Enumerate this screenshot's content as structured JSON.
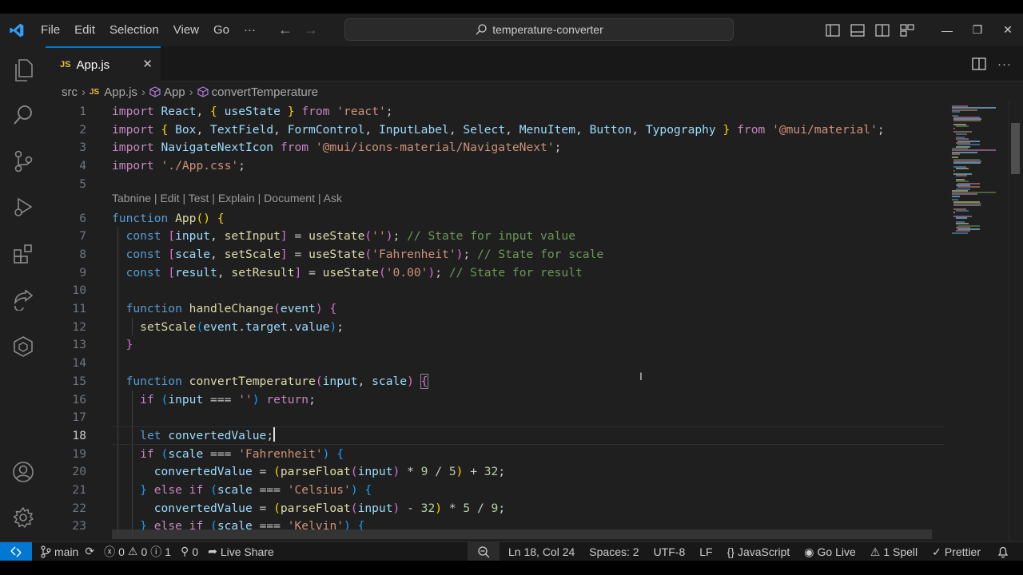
{
  "window": {
    "menu": [
      "File",
      "Edit",
      "Selection",
      "View",
      "Go",
      "···"
    ],
    "search_title": "temperature-converter",
    "controls": {
      "minimize": "—",
      "restore": "❐",
      "close": "✕"
    }
  },
  "tab": {
    "lang_badge": "JS",
    "label": "App.js",
    "close": "✕"
  },
  "breadcrumb": {
    "folder": "src",
    "file": "App.js",
    "symbol1": "App",
    "symbol2": "convertTemperature"
  },
  "codelens": "Tabnine | Edit | Test | Explain | Document | Ask",
  "editor": {
    "active_line": 18,
    "lines": [
      {
        "n": "1",
        "html": "<span class='kc'>import</span> <span class='var'>React</span>, <span class='b1'>{</span> <span class='var'>useState</span> <span class='b1'>}</span> <span class='kc'>from</span> <span class='str'>'react'</span>;"
      },
      {
        "n": "2",
        "html": "<span class='kc'>import</span> <span class='b1'>{</span> <span class='var'>Box</span>, <span class='var'>TextField</span>, <span class='var'>FormControl</span>, <span class='var'>InputLabel</span>, <span class='var'>Select</span>, <span class='var'>MenuItem</span>, <span class='var'>Button</span>, <span class='var'>Typography</span> <span class='b1'>}</span> <span class='kc'>from</span> <span class='str'>'@mui/material'</span>;"
      },
      {
        "n": "3",
        "html": "<span class='kc'>import</span> <span class='var'>NavigateNextIcon</span> <span class='kc'>from</span> <span class='str'>'@mui/icons-material/NavigateNext'</span>;"
      },
      {
        "n": "4",
        "html": "<span class='kc'>import</span> <span class='str'>'./App.css'</span>;"
      },
      {
        "n": "5",
        "html": ""
      },
      {
        "n": "6",
        "html": "<span class='kw'>function</span> <span class='fn'>App</span><span class='b1'>()</span> <span class='b1'>{</span>"
      },
      {
        "n": "7",
        "html": "  <span class='kw'>const</span> <span class='b2'>[</span><span class='var'>input</span>, <span class='fn'>setInput</span><span class='b2'>]</span> = <span class='fn'>useState</span><span class='b2'>(</span><span class='str'>''</span><span class='b2'>)</span>; <span class='cm'>// State for input value</span>"
      },
      {
        "n": "8",
        "html": "  <span class='kw'>const</span> <span class='b2'>[</span><span class='var'>scale</span>, <span class='fn'>setScale</span><span class='b2'>]</span> = <span class='fn'>useState</span><span class='b2'>(</span><span class='str'>'Fahrenheit'</span><span class='b2'>)</span>; <span class='cm'>// State for scale</span>"
      },
      {
        "n": "9",
        "html": "  <span class='kw'>const</span> <span class='b2'>[</span><span class='var'>result</span>, <span class='fn'>setResult</span><span class='b2'>]</span> = <span class='fn'>useState</span><span class='b2'>(</span><span class='str'>'0.00'</span><span class='b2'>)</span>; <span class='cm'>// State for result</span>"
      },
      {
        "n": "10",
        "html": ""
      },
      {
        "n": "11",
        "html": "  <span class='kw'>function</span> <span class='fn'>handleChange</span><span class='b2'>(</span><span class='var'>event</span><span class='b2'>)</span> <span class='b2'>{</span>"
      },
      {
        "n": "12",
        "html": "    <span class='fn'>setScale</span><span class='b3'>(</span><span class='var'>event</span>.<span class='var'>target</span>.<span class='var'>value</span><span class='b3'>)</span>;"
      },
      {
        "n": "13",
        "html": "  <span class='b2'>}</span>"
      },
      {
        "n": "14",
        "html": ""
      },
      {
        "n": "15",
        "html": "  <span class='kw'>function</span> <span class='fn'>convertTemperature</span><span class='b2'>(</span><span class='var'>input</span>, <span class='var'>scale</span><span class='b2'>)</span> <span class='b2 bm'>{</span>"
      },
      {
        "n": "16",
        "html": "    <span class='kc'>if</span> <span class='b3'>(</span><span class='var'>input</span> === <span class='str'>''</span><span class='b3'>)</span> <span class='kc'>return</span>;"
      },
      {
        "n": "17",
        "html": ""
      },
      {
        "n": "18",
        "html": "    <span class='kw'>let</span> <span class='var'>convertedValue</span>;<span class='caret'></span>"
      },
      {
        "n": "19",
        "html": "    <span class='kc'>if</span> <span class='b3'>(</span><span class='var'>scale</span> === <span class='str'>'Fahrenheit'</span><span class='b3'>)</span> <span class='b3'>{</span>"
      },
      {
        "n": "20",
        "html": "      <span class='var'>convertedValue</span> = <span class='b1'>(</span><span class='fn'>parseFloat</span><span class='b2'>(</span><span class='var'>input</span><span class='b2'>)</span> * <span class='num'>9</span> / <span class='num'>5</span><span class='b1'>)</span> + <span class='num'>32</span>;"
      },
      {
        "n": "21",
        "html": "    <span class='b3'>}</span> <span class='kc'>else if</span> <span class='b3'>(</span><span class='var'>scale</span> === <span class='str'>'Celsius'</span><span class='b3'>)</span> <span class='b3'>{</span>"
      },
      {
        "n": "22",
        "html": "      <span class='var'>convertedValue</span> = <span class='b1'>(</span><span class='fn'>parseFloat</span><span class='b2'>(</span><span class='var'>input</span><span class='b2'>)</span> - <span class='num'>32</span><span class='b1'>)</span> * <span class='num'>5</span> / <span class='num'>9</span>;"
      },
      {
        "n": "23",
        "html": "    <span class='b3'>}</span> <span class='kc'>else if</span> <span class='b3'>(</span><span class='var'>scale</span> === <span class='str'>'Kelvin'</span><span class='b3'>)</span> <span class='b3'>{</span>"
      }
    ]
  },
  "status": {
    "branch": "main",
    "problems_errors": "0",
    "problems_warnings": "0",
    "info": "1",
    "ports": "0",
    "live_share": "Live Share",
    "position": "Ln 18, Col 24",
    "spaces": "Spaces: 2",
    "encoding": "UTF-8",
    "eol": "LF",
    "language": "JavaScript",
    "go_live": "Go Live",
    "spell": "1 Spell",
    "prettier": "Prettier"
  },
  "colors": {
    "accent": "#0078d4",
    "background": "#1f1f1f",
    "js_badge": "#e8c13c"
  }
}
